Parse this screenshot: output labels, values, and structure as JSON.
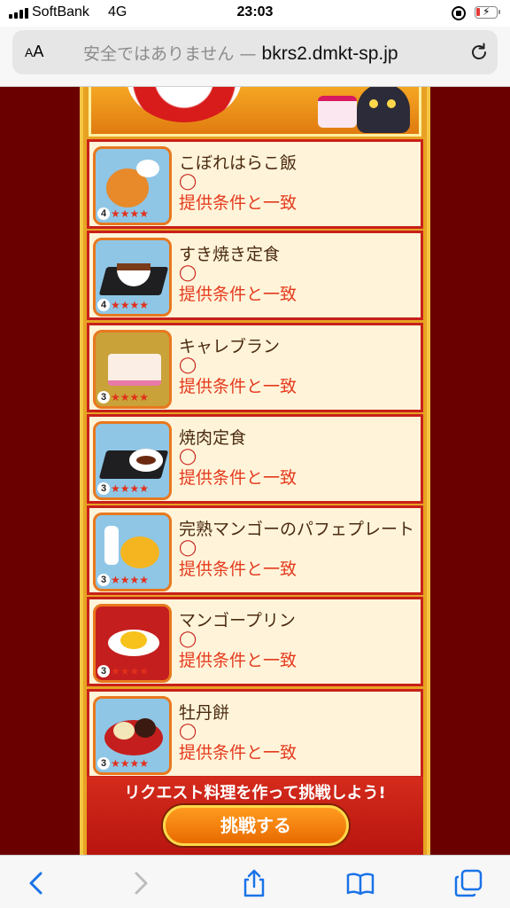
{
  "status_bar": {
    "carrier": "SoftBank",
    "network": "4G",
    "time": "23:03"
  },
  "address_bar": {
    "text_size_label": "AA",
    "security_note": "安全ではありません",
    "separator": " — ",
    "domain": "bkrs2.dmkt-sp.jp"
  },
  "colors": {
    "page_bg": "#6b0000",
    "panel_gold": "#e8a223",
    "item_border": "#c8201a",
    "match_text": "#e53a1e",
    "button_orange": "#ff9b1f"
  },
  "items": [
    {
      "name": "こぼれはらこ飯",
      "mark": "◯",
      "status": "提供条件と一致",
      "level": "4",
      "stars": "★★★★"
    },
    {
      "name": "すき焼き定食",
      "mark": "◯",
      "status": "提供条件と一致",
      "level": "4",
      "stars": "★★★★"
    },
    {
      "name": "キャレブラン",
      "mark": "◯",
      "status": "提供条件と一致",
      "level": "3",
      "stars": "★★★★"
    },
    {
      "name": "焼肉定食",
      "mark": "◯",
      "status": "提供条件と一致",
      "level": "3",
      "stars": "★★★★"
    },
    {
      "name": "完熟マンゴーのパフェプレート",
      "mark": "◯",
      "status": "提供条件と一致",
      "level": "3",
      "stars": "★★★★"
    },
    {
      "name": "マンゴープリン",
      "mark": "◯",
      "status": "提供条件と一致",
      "level": "3",
      "stars": "★★★★"
    },
    {
      "name": "牡丹餅",
      "mark": "◯",
      "status": "提供条件と一致",
      "level": "3",
      "stars": "★★★★"
    }
  ],
  "footer": {
    "prompt": "リクエスト料理を作って挑戦しよう!",
    "challenge_button": "挑戦する"
  },
  "toolbar": {
    "icons": [
      "back-icon",
      "forward-icon",
      "share-icon",
      "bookmarks-icon",
      "tabs-icon"
    ]
  }
}
